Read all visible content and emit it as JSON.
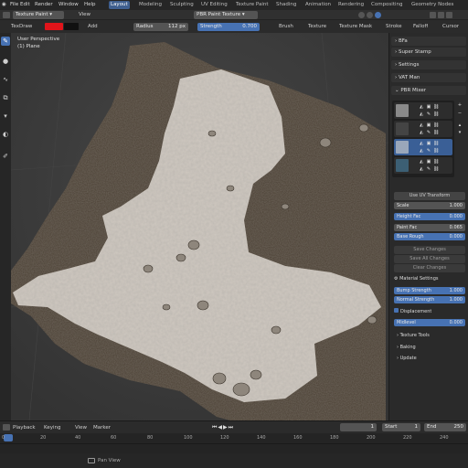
{
  "menubar": {
    "items": [
      "File",
      "Edit",
      "Render",
      "Window",
      "Help"
    ],
    "workspaces": [
      "Layout",
      "Modeling",
      "Sculpting",
      "UV Editing",
      "Texture Paint",
      "Shading",
      "Animation",
      "Rendering",
      "Compositing",
      "Geometry Nodes"
    ],
    "active_workspace": "Layout"
  },
  "toolheader": {
    "mode": "Texture Paint",
    "view": "View",
    "texture": "PBR Paint Texture"
  },
  "brush_header": {
    "tool": "TexDraw",
    "blend": "Add",
    "radius_label": "Radius",
    "radius_value": "112 px",
    "strength_label": "Strength",
    "strength_value": "0.700",
    "brush": "Brush",
    "texture": "Texture",
    "texture_mask": "Texture Mask",
    "stroke": "Stroke",
    "falloff": "Falloff",
    "cursor": "Cursor",
    "color1": "#e0141a",
    "color2": "#111111"
  },
  "viewport": {
    "title": "User Perspective",
    "subtitle": "(1) Plane"
  },
  "panel": {
    "sections": [
      "BFa",
      "Super Stamp",
      "Settings",
      "VAT Man",
      "PBR Mixer"
    ],
    "layer_button": "Use UV Transform",
    "props": [
      {
        "label": "Scale",
        "value": "1.000",
        "blue": false
      },
      {
        "label": "Height Fac",
        "value": "0.000",
        "blue": true
      },
      {
        "label": "Paint Fac",
        "value": "0.065",
        "blue": false
      },
      {
        "label": "Base Rough",
        "value": "0.000",
        "blue": true
      }
    ],
    "disabled_buttons": [
      "Save Changes",
      "Save All Changes",
      "Clear Changes"
    ],
    "material_settings": "Material Settings",
    "bump_strength_label": "Bump Strength",
    "bump_strength_value": "1.000",
    "normal_strength_label": "Normal Strength",
    "normal_strength_value": "1.000",
    "displacement": "Displacement",
    "midlevel_label": "Midlevel",
    "midlevel_value": "0.000",
    "subsections": [
      "Texture Tools",
      "Baking",
      "Update"
    ]
  },
  "timeline": {
    "playback": "Playback",
    "keying": "Keying",
    "view": "View",
    "marker": "Marker",
    "current_frame": "1",
    "start_label": "Start",
    "start_value": "1",
    "end_label": "End",
    "end_value": "250",
    "ticks": [
      "0",
      "20",
      "40",
      "60",
      "80",
      "100",
      "120",
      "140",
      "160",
      "180",
      "200",
      "220",
      "240"
    ]
  },
  "statusbar": {
    "hint": "Pan View"
  }
}
